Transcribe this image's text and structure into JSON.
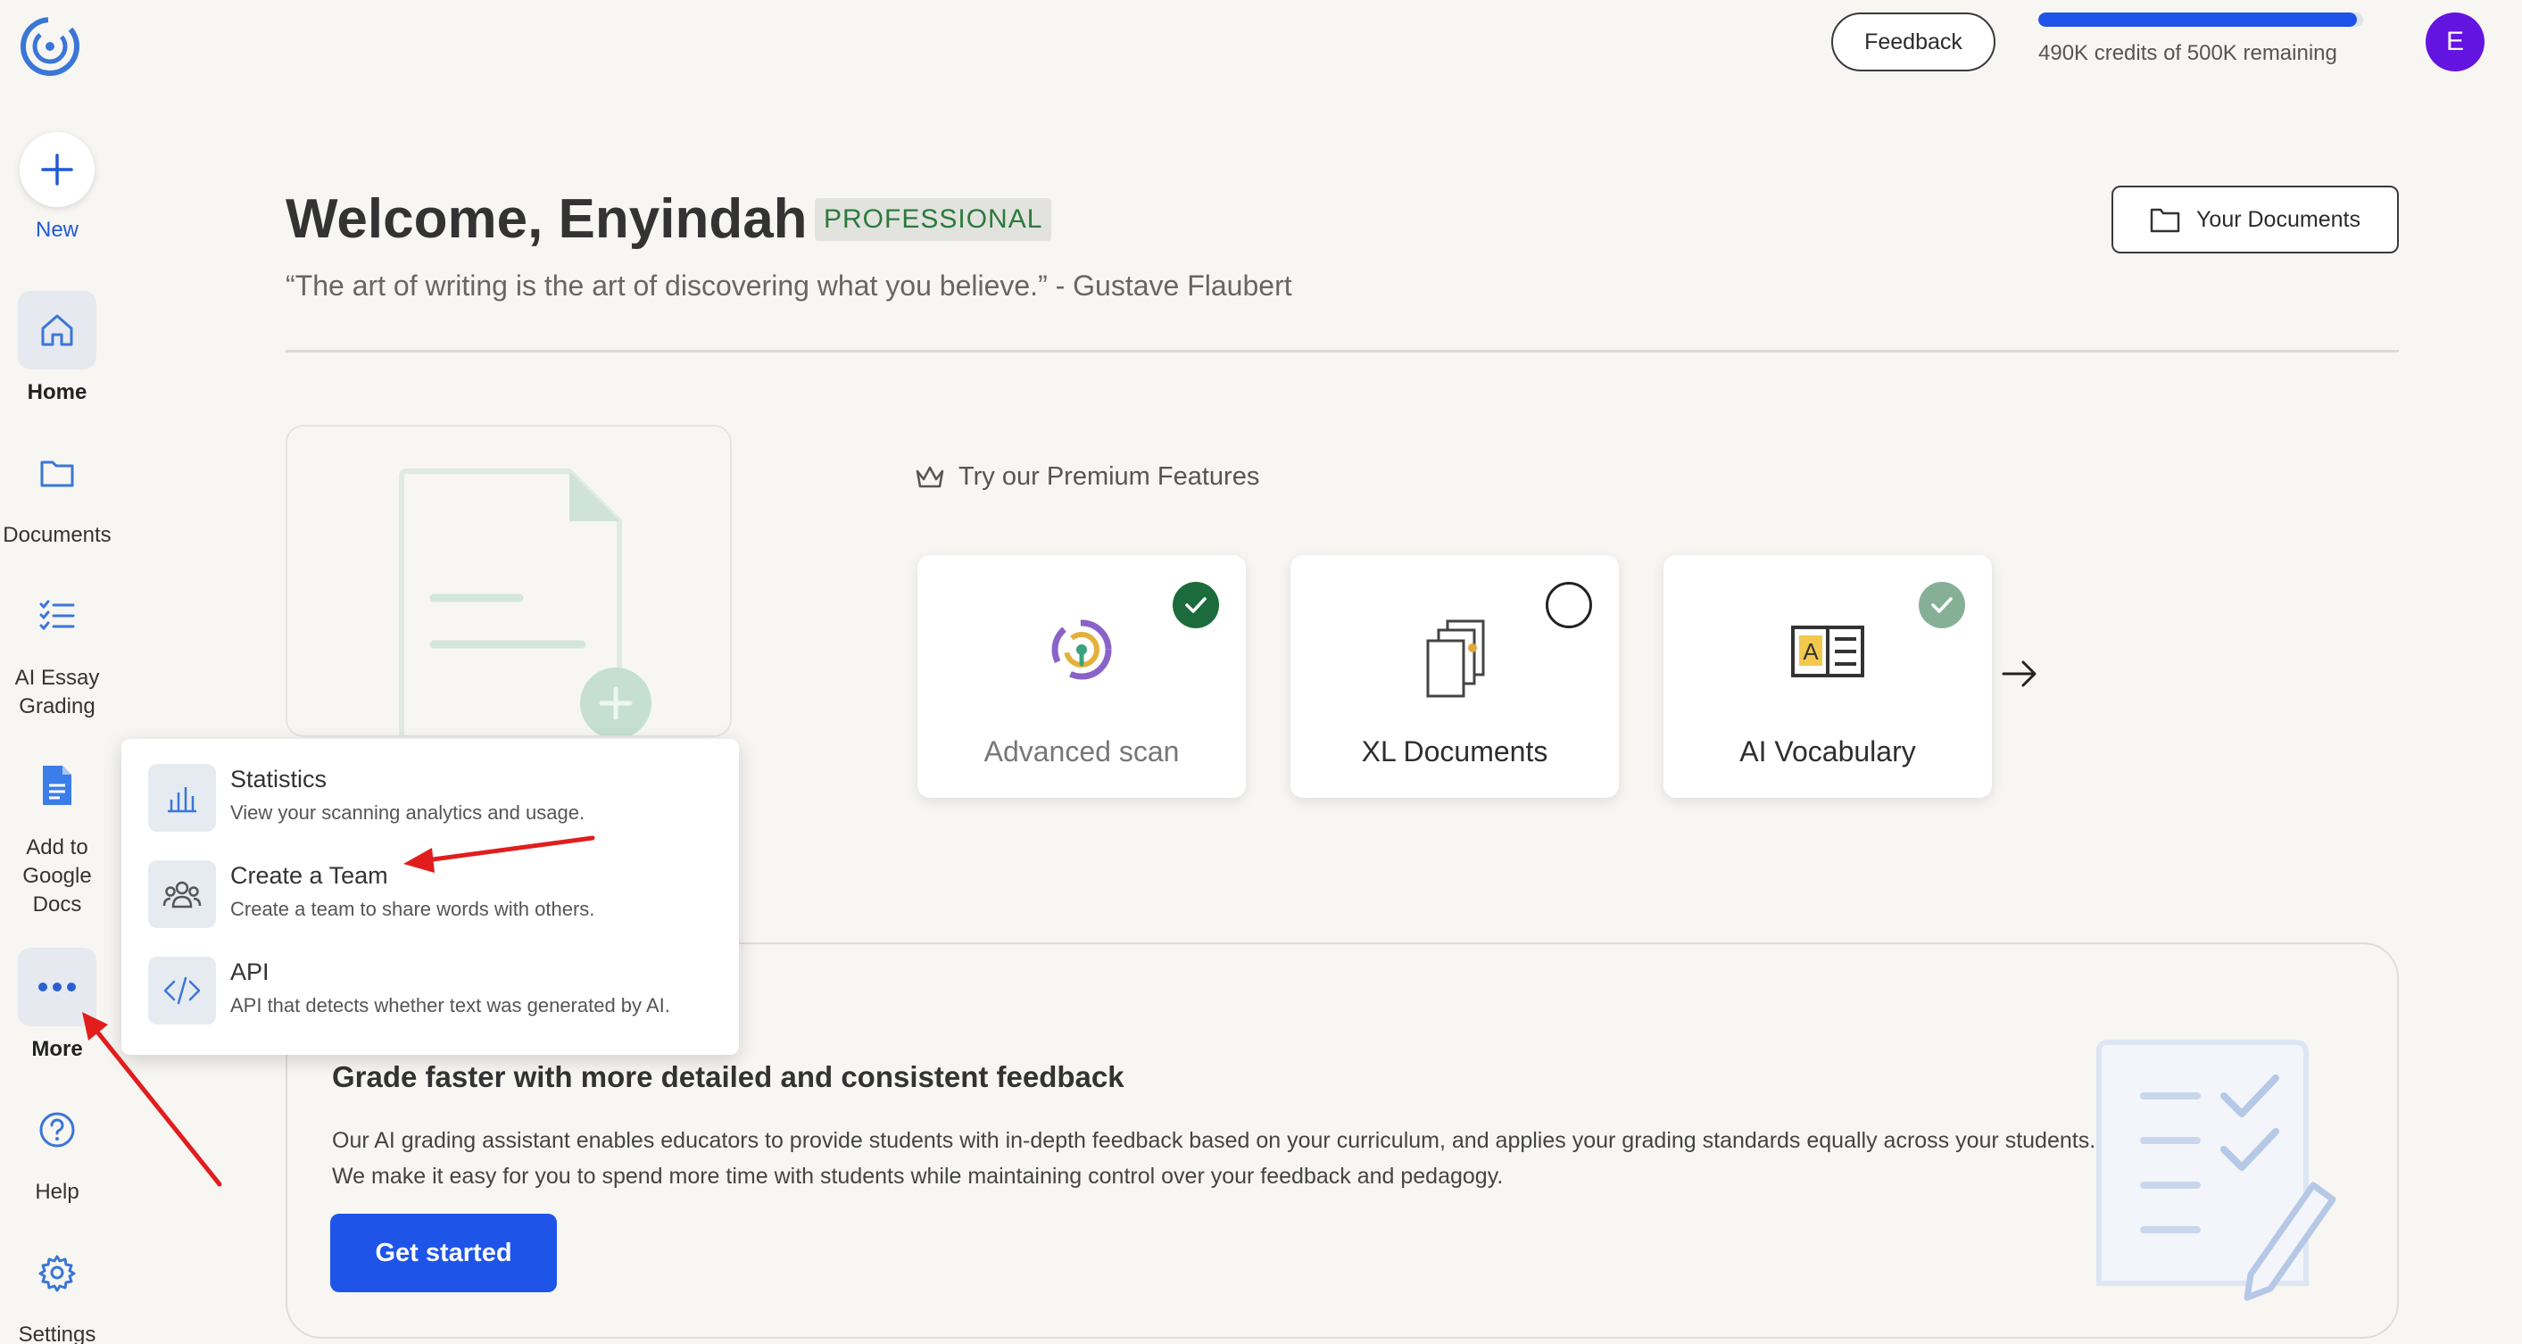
{
  "app": {
    "accent": "#1e55e8",
    "avatar_color": "#6414e0"
  },
  "sidebar": {
    "new_label": "New",
    "items": [
      {
        "label": "Home",
        "icon": "home-icon"
      },
      {
        "label": "Documents",
        "icon": "folder-icon"
      },
      {
        "label": "AI Essay\nGrading",
        "icon": "checklist-icon"
      },
      {
        "label": "Add to\nGoogle\nDocs",
        "icon": "google-docs-icon"
      },
      {
        "label": "More",
        "icon": "more-dots-icon"
      },
      {
        "label": "Help",
        "icon": "help-icon"
      },
      {
        "label": "Settings",
        "icon": "gear-icon"
      }
    ]
  },
  "topbar": {
    "feedback_label": "Feedback",
    "credits_text": "490K credits of 500K remaining",
    "credits_fraction": 0.98,
    "avatar_initial": "E"
  },
  "header": {
    "welcome": "Welcome, Enyindah",
    "plan_badge": "PROFESSIONAL",
    "quote": "“The art of writing is the art of discovering what you believe.” - Gustave Flaubert",
    "your_documents_label": "Your Documents"
  },
  "premium": {
    "title": "Try our Premium Features",
    "features": [
      {
        "label": "Advanced scan",
        "status": "checked"
      },
      {
        "label": "XL Documents",
        "status": "unchecked"
      },
      {
        "label": "AI Vocabulary",
        "status": "checked-light"
      }
    ]
  },
  "grading": {
    "title": "Grade faster with more detailed and consistent feedback",
    "body": "Our AI grading assistant enables educators to provide students with in-depth feedback based on your curriculum, and applies your grading standards equally across your students. We make it easy for you to spend more time with students while maintaining control over your feedback and pedagogy.",
    "cta_label": "Get started"
  },
  "more_menu": {
    "items": [
      {
        "title": "Statistics",
        "desc": "View your scanning analytics and usage.",
        "icon": "bar-chart-icon"
      },
      {
        "title": "Create a Team",
        "desc": "Create a team to share words with others.",
        "icon": "team-icon"
      },
      {
        "title": "API",
        "desc": "API that detects whether text was generated by AI.",
        "icon": "code-icon"
      }
    ]
  }
}
